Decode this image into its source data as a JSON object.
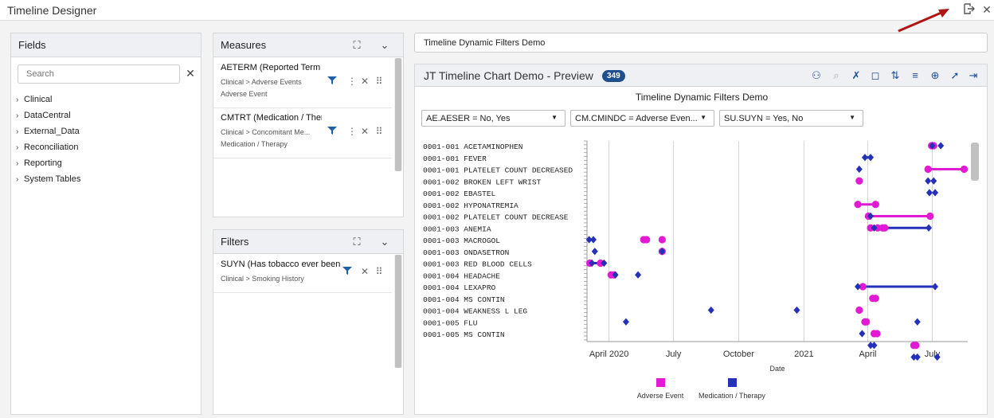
{
  "app": {
    "title": "Timeline Designer"
  },
  "fields": {
    "title": "Fields",
    "search_placeholder": "Search",
    "tree": [
      "Clinical",
      "DataCentral",
      "External_Data",
      "Reconciliation",
      "Reporting",
      "System Tables"
    ]
  },
  "measures": {
    "title": "Measures",
    "items": [
      {
        "name": "AETERM (Reported Term f",
        "path": "Clinical > Adverse Events",
        "type": "Adverse Event"
      },
      {
        "name": "CMTRT (Medication / Ther",
        "path": "Clinical > Concomitant Me...",
        "type": "Medication / Therapy"
      }
    ]
  },
  "filters": {
    "title": "Filters",
    "items": [
      {
        "name": "SUYN (Has tobacco ever been",
        "path": "Clinical > Smoking History"
      }
    ]
  },
  "chart_name_value": "Timeline Dynamic Filters Demo",
  "preview": {
    "title": "JT Timeline Chart Demo - Preview",
    "count": "349",
    "subtitle": "Timeline Dynamic Filters Demo",
    "dropdowns": [
      "AE.AESER = No, Yes",
      "CM.CMINDC = Adverse Even...",
      "SU.SUYN = Yes, No"
    ]
  },
  "chart_data": {
    "type": "scatter",
    "subtype": "timeline",
    "title": "Timeline Dynamic Filters Demo",
    "xlabel": "Date",
    "xlim": [
      "2020-03-01",
      "2021-08-20"
    ],
    "x_ticks": [
      {
        "date": "2020-04-01",
        "label": "April 2020"
      },
      {
        "date": "2020-07-01",
        "label": "July"
      },
      {
        "date": "2020-10-01",
        "label": "October"
      },
      {
        "date": "2021-01-01",
        "label": "2021"
      },
      {
        "date": "2021-04-01",
        "label": "April"
      },
      {
        "date": "2021-07-01",
        "label": "July"
      }
    ],
    "categories": [
      "0001-001 ACETAMINOPHEN",
      "0001-001 FEVER",
      "0001-001 PLATELET COUNT DECREASED",
      "0001-002 BROKEN LEFT WRIST",
      "0001-002 EBASTEL",
      "0001-002 HYPONATREMIA",
      "0001-002 PLATELET COUNT DECREASE",
      "0001-003 ANEMIA",
      "0001-003 MACROGOL",
      "0001-003 ONDASETRON",
      "0001-003 RED BLOOD CELLS",
      "0001-004 HEADACHE",
      "0001-004 LEXAPRO",
      "0001-004 MS CONTIN",
      "0001-004 WEAKNESS L LEG",
      "0001-005 FLU",
      "0001-005 MS CONTIN"
    ],
    "legend": {
      "placement": "bottom"
    },
    "series": [
      {
        "name": "Adverse Event",
        "color": "#e21ad3",
        "marker": "circle",
        "points": [
          {
            "row": 0,
            "date": "2021-06-30"
          },
          {
            "row": 0,
            "date": "2021-07-01"
          },
          {
            "row": 0,
            "date": "2021-07-03"
          },
          {
            "row": 2,
            "date": "2021-06-25"
          },
          {
            "row": 2,
            "date": "2021-08-15"
          },
          {
            "row": 3,
            "date": "2021-03-20"
          },
          {
            "row": 5,
            "date": "2021-03-18"
          },
          {
            "row": 5,
            "date": "2021-04-12"
          },
          {
            "row": 6,
            "date": "2021-04-02"
          },
          {
            "row": 6,
            "date": "2021-06-28"
          },
          {
            "row": 7,
            "date": "2021-04-05"
          },
          {
            "row": 7,
            "date": "2021-04-15"
          },
          {
            "row": 7,
            "date": "2021-04-22"
          },
          {
            "row": 7,
            "date": "2021-04-25"
          },
          {
            "row": 8,
            "date": "2020-05-20"
          },
          {
            "row": 8,
            "date": "2020-05-24"
          },
          {
            "row": 8,
            "date": "2020-06-15"
          },
          {
            "row": 9,
            "date": "2020-06-15"
          },
          {
            "row": 10,
            "date": "2020-03-05"
          },
          {
            "row": 10,
            "date": "2020-03-20"
          },
          {
            "row": 11,
            "date": "2020-04-04"
          },
          {
            "row": 11,
            "date": "2020-04-08"
          },
          {
            "row": 12,
            "date": "2021-03-25"
          },
          {
            "row": 13,
            "date": "2021-04-08"
          },
          {
            "row": 13,
            "date": "2021-04-12"
          },
          {
            "row": 14,
            "date": "2021-03-20"
          },
          {
            "row": 15,
            "date": "2021-03-28"
          },
          {
            "row": 15,
            "date": "2021-03-30"
          },
          {
            "row": 16,
            "date": "2021-04-10"
          },
          {
            "row": 16,
            "date": "2021-04-14"
          },
          {
            "row": 17,
            "date": "2021-06-05"
          },
          {
            "row": 17,
            "date": "2021-06-08"
          }
        ],
        "ranges": [
          {
            "row": 2,
            "start": "2021-06-25",
            "end": "2021-08-15"
          },
          {
            "row": 5,
            "start": "2021-03-18",
            "end": "2021-04-12"
          },
          {
            "row": 6,
            "start": "2021-04-02",
            "end": "2021-06-28"
          },
          {
            "row": 8,
            "start": "2020-05-20",
            "end": "2020-05-24"
          },
          {
            "row": 10,
            "start": "2020-03-05",
            "end": "2020-03-20"
          }
        ]
      },
      {
        "name": "Medication / Therapy",
        "color": "#2431b8",
        "marker": "diamond",
        "points": [
          {
            "row": 0,
            "date": "2021-07-01"
          },
          {
            "row": 0,
            "date": "2021-07-13"
          },
          {
            "row": 1,
            "date": "2021-03-28"
          },
          {
            "row": 1,
            "date": "2021-04-05"
          },
          {
            "row": 2,
            "date": "2021-03-20"
          },
          {
            "row": 3,
            "date": "2021-06-25"
          },
          {
            "row": 3,
            "date": "2021-07-03"
          },
          {
            "row": 4,
            "date": "2021-06-27"
          },
          {
            "row": 4,
            "date": "2021-07-05"
          },
          {
            "row": 6,
            "date": "2021-04-05"
          },
          {
            "row": 7,
            "date": "2021-04-10"
          },
          {
            "row": 7,
            "date": "2021-06-26"
          },
          {
            "row": 8,
            "date": "2020-03-04"
          },
          {
            "row": 8,
            "date": "2020-03-10"
          },
          {
            "row": 9,
            "date": "2020-03-12"
          },
          {
            "row": 9,
            "date": "2020-06-15"
          },
          {
            "row": 10,
            "date": "2020-03-08"
          },
          {
            "row": 10,
            "date": "2020-03-25"
          },
          {
            "row": 11,
            "date": "2020-04-10"
          },
          {
            "row": 11,
            "date": "2020-05-12"
          },
          {
            "row": 12,
            "date": "2021-03-18"
          },
          {
            "row": 12,
            "date": "2021-07-05"
          },
          {
            "row": 14,
            "date": "2020-08-23"
          },
          {
            "row": 14,
            "date": "2020-12-22"
          },
          {
            "row": 15,
            "date": "2020-04-25"
          },
          {
            "row": 15,
            "date": "2021-06-10"
          },
          {
            "row": 16,
            "date": "2021-03-24"
          },
          {
            "row": 17,
            "date": "2021-04-05"
          },
          {
            "row": 17,
            "date": "2021-04-10"
          },
          {
            "row": 18,
            "date": "2021-06-05"
          },
          {
            "row": 18,
            "date": "2021-06-10"
          },
          {
            "row": 18,
            "date": "2021-07-08"
          }
        ],
        "ranges": [
          {
            "row": 1,
            "start": "2021-03-28",
            "end": "2021-04-05"
          },
          {
            "row": 7,
            "start": "2021-04-10",
            "end": "2021-06-26"
          },
          {
            "row": 8,
            "start": "2020-03-04",
            "end": "2020-03-10"
          },
          {
            "row": 10,
            "start": "2020-03-08",
            "end": "2020-03-25"
          },
          {
            "row": 12,
            "start": "2021-03-18",
            "end": "2021-07-05"
          }
        ]
      }
    ]
  }
}
